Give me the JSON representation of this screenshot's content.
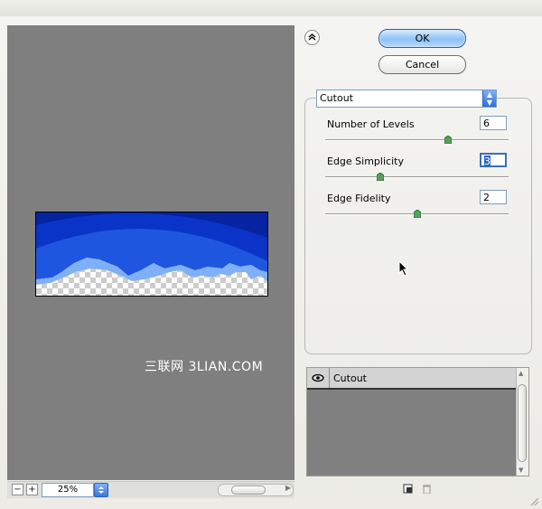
{
  "dialog": {
    "ok_label": "OK",
    "cancel_label": "Cancel"
  },
  "preview": {
    "watermark": "三联网 3LIAN.COM"
  },
  "zoom": {
    "value": "25%",
    "minus": "−",
    "plus": "+"
  },
  "filter": {
    "selected": "Cutout",
    "params": [
      {
        "label": "Number of Levels",
        "value": "6",
        "slider_fraction": 0.67
      },
      {
        "label": "Edge Simplicity",
        "value": "3",
        "slider_fraction": 0.3
      },
      {
        "label": "Edge Fidelity",
        "value": "2",
        "slider_fraction": 0.5
      }
    ]
  },
  "layers": {
    "items": [
      {
        "name": "Cutout"
      }
    ]
  }
}
